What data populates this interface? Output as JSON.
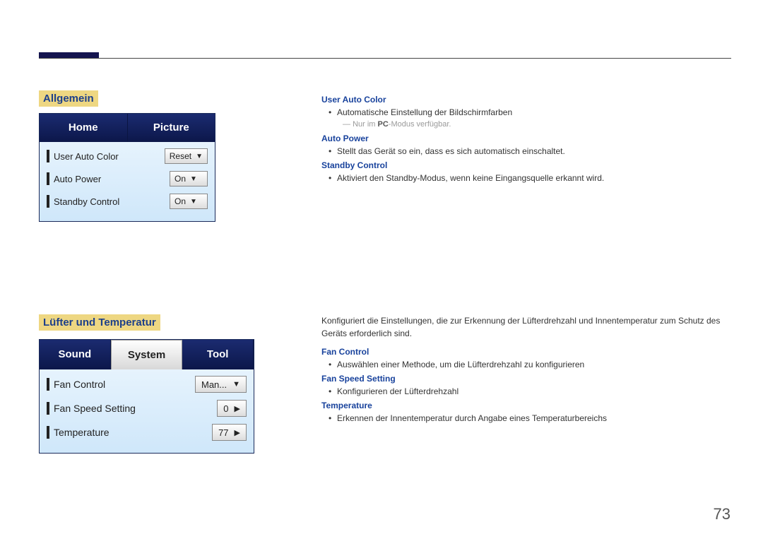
{
  "pageNumber": "73",
  "section1": {
    "title": "Allgemein",
    "shot": {
      "tabs": [
        "Home",
        "Picture"
      ],
      "rows": [
        {
          "label": "User Auto Color",
          "value": "Reset"
        },
        {
          "label": "Auto Power",
          "value": "On"
        },
        {
          "label": "Standby Control",
          "value": "On"
        }
      ]
    },
    "desc": {
      "uac_h": "User Auto Color",
      "uac_b": "Automatische Einstellung der Bildschirmfarben",
      "uac_note_pre": "Nur im ",
      "uac_note_pc": "PC",
      "uac_note_post": "-Modus verfügbar.",
      "ap_h": "Auto Power",
      "ap_b": "Stellt das Gerät so ein, dass es sich automatisch einschaltet.",
      "sc_h": "Standby Control",
      "sc_b": "Aktiviert den Standby-Modus, wenn keine Eingangsquelle erkannt wird."
    }
  },
  "section2": {
    "title": "Lüfter und Temperatur",
    "shot": {
      "tabs": {
        "left": "Sound",
        "mid": "System",
        "right": "Tool"
      },
      "rows": [
        {
          "label": "Fan Control",
          "value": "Man...",
          "arrow": "▼"
        },
        {
          "label": "Fan Speed Setting",
          "value": "0",
          "arrow": "▶"
        },
        {
          "label": "Temperature",
          "value": "77",
          "arrow": "▶"
        }
      ]
    },
    "desc": {
      "intro": "Konfiguriert die Einstellungen, die zur Erkennung der Lüfterdrehzahl und Innentemperatur zum Schutz des Geräts erforderlich sind.",
      "fc_h": "Fan Control",
      "fc_b": "Auswählen einer Methode, um die Lüfterdrehzahl zu konfigurieren",
      "fss_h": "Fan Speed Setting",
      "fss_b": "Konfigurieren der Lüfterdrehzahl",
      "t_h": "Temperature",
      "t_b": "Erkennen der Innentemperatur durch Angabe eines Temperaturbereichs"
    }
  }
}
